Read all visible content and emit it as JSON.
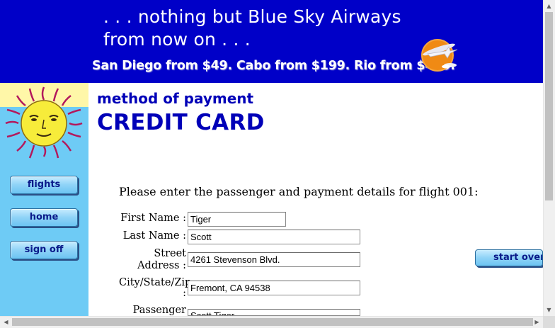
{
  "banner": {
    "tagline_line1": ". . . nothing but Blue Sky Airways",
    "tagline_line2": "from now on . . .",
    "promo": "San Diego from $49. Cabo from $199. Rio from $499.",
    "plane_logo_icon": "airplane-sun-icon"
  },
  "sidebar": {
    "logo_icon": "sun-face-icon",
    "buttons": [
      {
        "label": "flights"
      },
      {
        "label": "home"
      },
      {
        "label": "sign off"
      }
    ]
  },
  "main": {
    "subtitle": "method of payment",
    "title": "CREDIT CARD",
    "intro": "Please enter the passenger and payment details for flight 001:",
    "form": {
      "first_name_label": "First Name :",
      "first_name_value": "Tiger",
      "last_name_label": "Last Name :",
      "last_name_value": "Scott",
      "street_label_1": "Street",
      "street_label_2": "Address :",
      "street_value": "4261 Stevenson Blvd.",
      "city_label": "City/State/Zip",
      "city_label_colon": ":",
      "city_value": "Fremont, CA 94538",
      "passenger_label": "Passenger",
      "passenger_value": "Scott Tiger"
    },
    "start_over_label": "start over"
  },
  "colors": {
    "banner_bg": "#0000c8",
    "sidebar_bg": "#6ecbf5",
    "heading": "#0000b8"
  }
}
